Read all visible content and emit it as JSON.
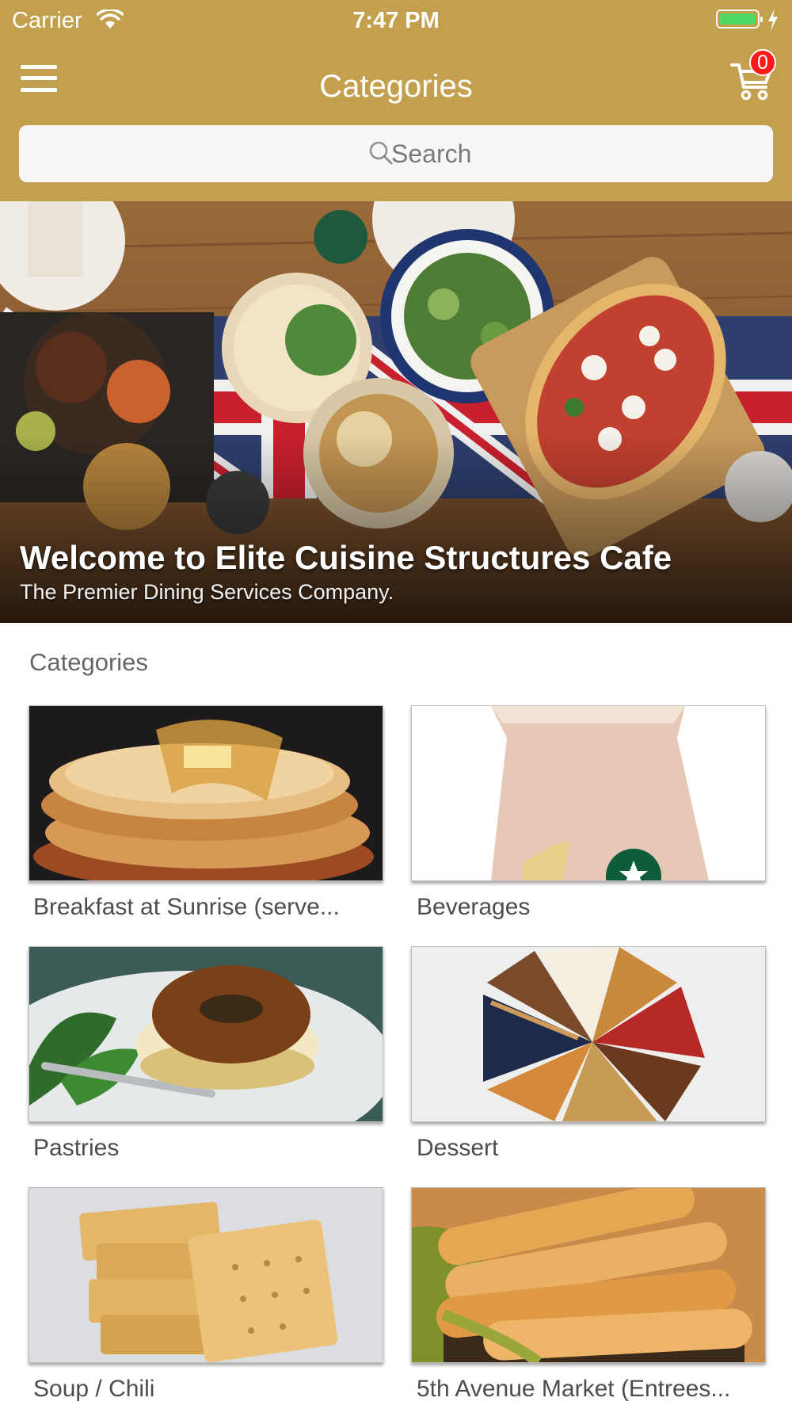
{
  "status_bar": {
    "carrier": "Carrier",
    "time": "7:47 PM"
  },
  "nav": {
    "title": "Categories",
    "cart_count": "0"
  },
  "search": {
    "placeholder": "Search"
  },
  "hero": {
    "title": "Welcome to Elite Cuisine Structures Cafe",
    "subtitle": "The Premier Dining Services Company."
  },
  "section": {
    "title": "Categories"
  },
  "categories": [
    {
      "label": "Breakfast at Sunrise (serve..."
    },
    {
      "label": "Beverages"
    },
    {
      "label": "Pastries"
    },
    {
      "label": "Dessert"
    },
    {
      "label": "Soup / Chili"
    },
    {
      "label": "5th Avenue Market (Entrees..."
    }
  ],
  "colors": {
    "brand": "#c3a04e",
    "badge": "#ff1a1a",
    "battery": "#4cd964"
  }
}
